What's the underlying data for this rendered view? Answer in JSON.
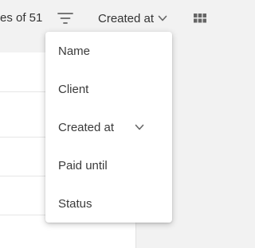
{
  "toolbar": {
    "pager_text": "es of 51",
    "filter_icon": "filter-icon",
    "sort_label": "Created at",
    "sort_chevron_icon": "chevron-down-icon",
    "view_icon": "grid-view-icon"
  },
  "sort_menu": {
    "items": [
      {
        "label": "Name",
        "selected": false
      },
      {
        "label": "Client",
        "selected": false
      },
      {
        "label": "Created at",
        "selected": true
      },
      {
        "label": "Paid until",
        "selected": false
      },
      {
        "label": "Status",
        "selected": false
      }
    ]
  },
  "colors": {
    "background": "#f2f2f2",
    "panel": "#ffffff",
    "text": "#3a3a3a",
    "icon": "#666666"
  }
}
